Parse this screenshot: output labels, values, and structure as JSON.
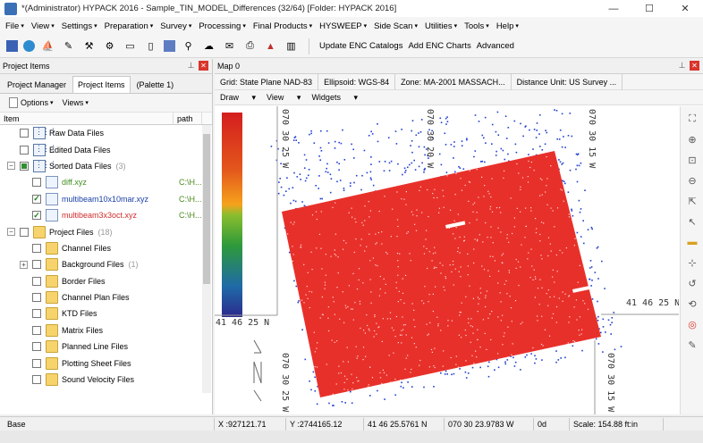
{
  "window": {
    "title": "*(Administrator) HYPACK 2016 - Sample_TIN_MODEL_Differences (32/64) [Folder: HYPACK 2016]",
    "minimize": "—",
    "maximize": "☐",
    "close": "✕"
  },
  "menu": [
    "File",
    "View",
    "Settings",
    "Preparation",
    "Survey",
    "Processing",
    "Final Products",
    "HYSWEEP",
    "Side Scan",
    "Utilities",
    "Tools",
    "Help"
  ],
  "toolbar": {
    "update_enc": "Update ENC Catalogs",
    "add_enc": "Add ENC Charts",
    "advanced": "Advanced"
  },
  "left_panel": {
    "title": "Project Items",
    "tabs": [
      "Project Manager",
      "Project Items",
      "(Palette 1)"
    ],
    "options": "Options",
    "views": "Views",
    "columns": [
      "Item",
      "path"
    ],
    "items": [
      {
        "label": "Raw Data Files",
        "count": "",
        "path": "",
        "indent": 0,
        "expander": "",
        "check": "off",
        "icon": "grid",
        "color": "#000000"
      },
      {
        "label": "Edited Data Files",
        "count": "",
        "path": "",
        "indent": 0,
        "expander": "",
        "check": "off",
        "icon": "grid",
        "color": "#000000"
      },
      {
        "label": "Sorted Data Files",
        "count": "(3)",
        "path": "",
        "indent": 0,
        "expander": "⊟",
        "check": "part",
        "icon": "grid",
        "color": "#000000"
      },
      {
        "label": "diff.xyz",
        "count": "",
        "path": "C:\\H...",
        "indent": 1,
        "expander": "",
        "check": "off",
        "icon": "doc",
        "color": "#3e8e1c"
      },
      {
        "label": "multibeam10x10mar.xyz",
        "count": "",
        "path": "C:\\H...",
        "indent": 1,
        "expander": "",
        "check": "on",
        "icon": "doc",
        "color": "#1a3fa8"
      },
      {
        "label": "multibeam3x3oct.xyz",
        "count": "",
        "path": "C:\\H...",
        "indent": 1,
        "expander": "",
        "check": "on",
        "icon": "doc",
        "color": "#d22b2b"
      },
      {
        "label": "Project Files",
        "count": "(18)",
        "path": "",
        "indent": 0,
        "expander": "⊟",
        "check": "off",
        "icon": "folder",
        "color": "#000000"
      },
      {
        "label": "Channel Files",
        "count": "",
        "path": "",
        "indent": 1,
        "expander": "",
        "check": "off",
        "icon": "folder",
        "color": "#000000"
      },
      {
        "label": "Background Files",
        "count": "(1)",
        "path": "",
        "indent": 1,
        "expander": "⊞",
        "check": "off",
        "icon": "folder",
        "color": "#000000"
      },
      {
        "label": "Border Files",
        "count": "",
        "path": "",
        "indent": 1,
        "expander": "",
        "check": "off",
        "icon": "folder",
        "color": "#000000"
      },
      {
        "label": "Channel Plan Files",
        "count": "",
        "path": "",
        "indent": 1,
        "expander": "",
        "check": "off",
        "icon": "folder",
        "color": "#000000"
      },
      {
        "label": "KTD Files",
        "count": "",
        "path": "",
        "indent": 1,
        "expander": "",
        "check": "off",
        "icon": "folder",
        "color": "#000000"
      },
      {
        "label": "Matrix Files",
        "count": "",
        "path": "",
        "indent": 1,
        "expander": "",
        "check": "off",
        "icon": "folder",
        "color": "#000000"
      },
      {
        "label": "Planned Line Files",
        "count": "",
        "path": "",
        "indent": 1,
        "expander": "",
        "check": "off",
        "icon": "folder",
        "color": "#000000"
      },
      {
        "label": "Plotting Sheet Files",
        "count": "",
        "path": "",
        "indent": 1,
        "expander": "",
        "check": "off",
        "icon": "folder",
        "color": "#000000"
      },
      {
        "label": "Sound Velocity Files",
        "count": "",
        "path": "",
        "indent": 1,
        "expander": "",
        "check": "off",
        "icon": "folder",
        "color": "#000000"
      }
    ]
  },
  "map": {
    "title": "Map 0",
    "info": [
      "Grid: State Plane NAD-83",
      "Ellipsoid: WGS-84",
      "Zone: MA-2001 MASSACH...",
      "Distance Unit: US Survey ..."
    ],
    "tools": [
      "Draw",
      "View",
      "Widgets"
    ],
    "labels": {
      "lon_top_left": "070 30 25 W",
      "lon_top_mid": "070 30 20 W",
      "lon_top_right": "070 30 15 W",
      "lon_bottom_left": "070 30 25 W",
      "lon_bottom_right": "070 30 15 W",
      "lat_left": "41 46 25 N",
      "lat_right": "41 46 25 N"
    },
    "colors": {
      "survey": "#e8302a",
      "soundings": "#1f3fd0"
    }
  },
  "status": {
    "base": "Base",
    "x": "X :927121.71",
    "y": "Y :2744165.12",
    "lat": "41 46 25.5761 N",
    "lon": "070 30 23.9783 W",
    "deg": "0d",
    "scale": "Scale: 154.88 ft:in"
  }
}
